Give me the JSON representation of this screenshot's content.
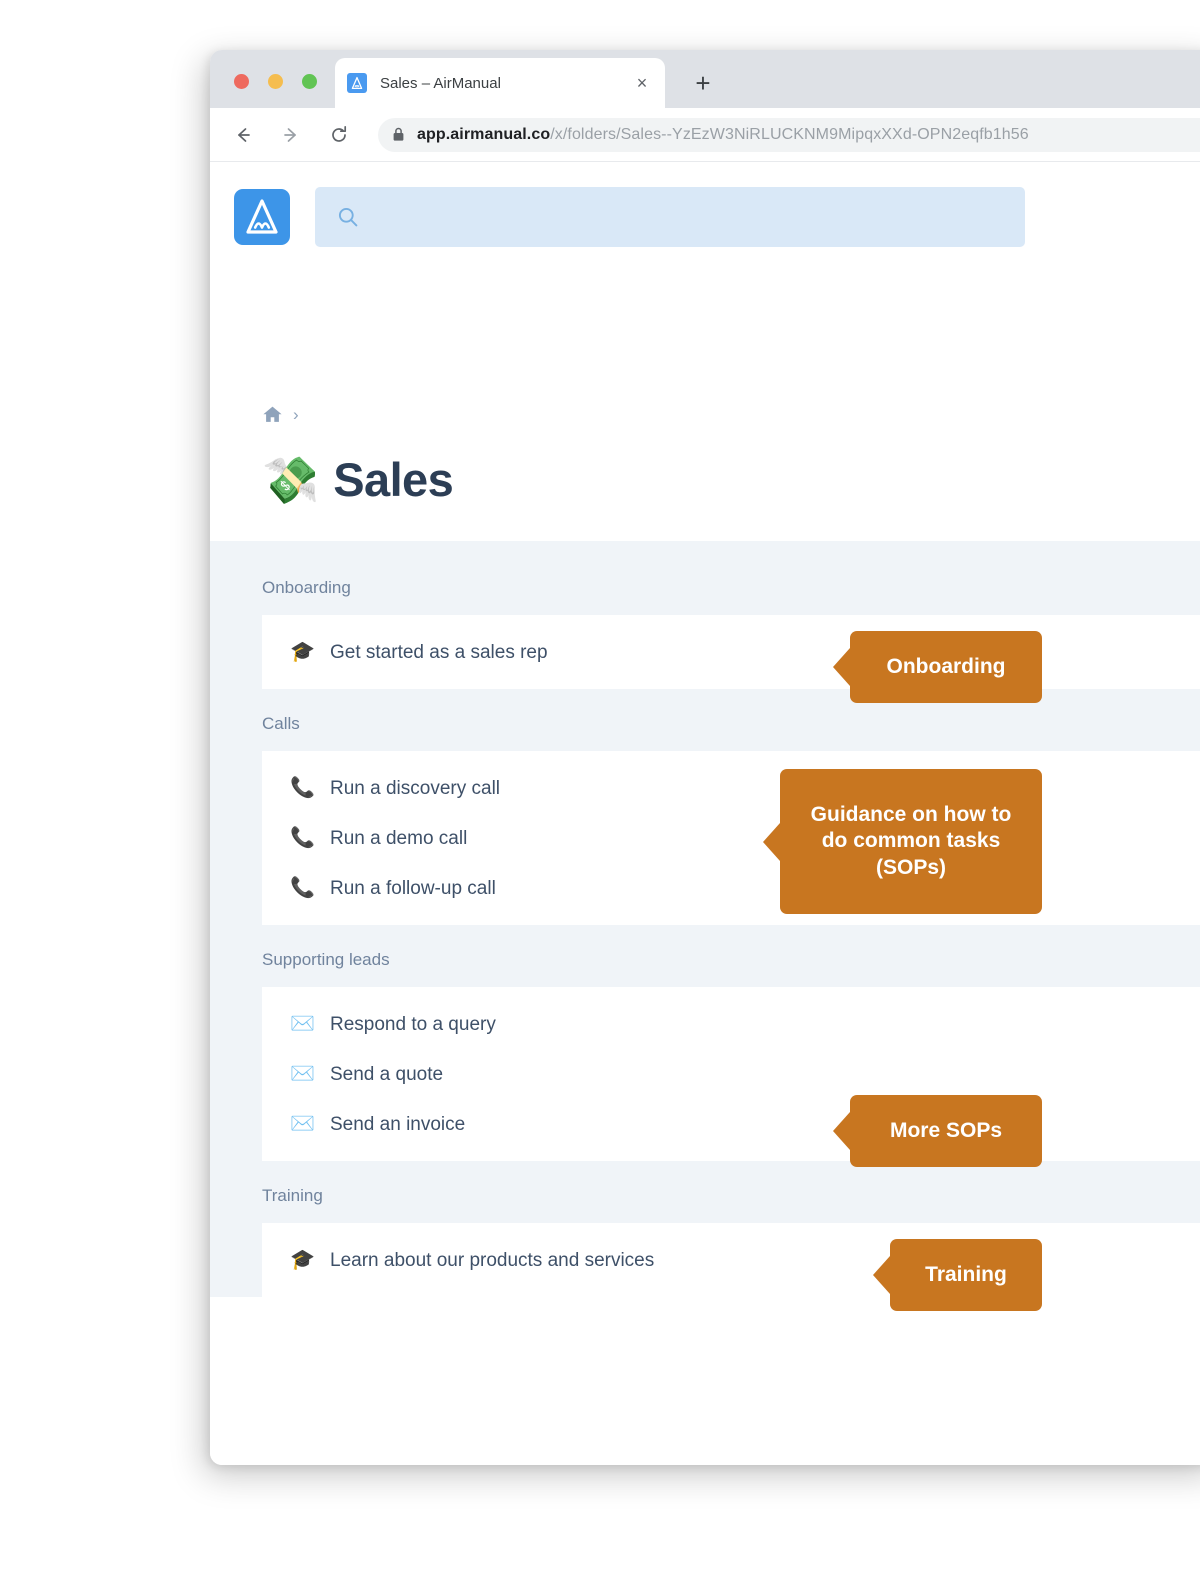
{
  "browser": {
    "traffic_lights": [
      {
        "name": "close",
        "color": "#ee6a5f"
      },
      {
        "name": "minimize",
        "color": "#f5bd4f"
      },
      {
        "name": "zoom",
        "color": "#61c454"
      }
    ],
    "tab": {
      "title": "Sales – AirManual",
      "favicon": "airmanual-logo-icon",
      "close_label": "×"
    },
    "new_tab_label": "+",
    "nav": {
      "back": "←",
      "forward": "→",
      "reload": "↻"
    },
    "omnibox": {
      "lock": "lock-icon",
      "host": "app.airmanual.co",
      "path": "/x/folders/Sales--YzEzW3NiRLUCKNM9MipqxXXd-OPN2eqfb1h56"
    }
  },
  "app": {
    "logo_name": "airmanual-logo",
    "search": {
      "placeholder": "",
      "value": "",
      "icon": "search-icon"
    },
    "breadcrumb": {
      "home_icon": "home-icon",
      "separator": "›"
    },
    "page": {
      "emoji": "💸",
      "title": "Sales"
    },
    "sections": [
      {
        "label": "Onboarding",
        "items": [
          {
            "icon": "🎓",
            "icon_name": "graduation-cap-icon",
            "label": "Get started as a sales rep"
          }
        ]
      },
      {
        "label": "Calls",
        "items": [
          {
            "icon": "📞",
            "icon_name": "telephone-icon",
            "label": "Run a discovery call"
          },
          {
            "icon": "📞",
            "icon_name": "telephone-icon",
            "label": "Run a demo call"
          },
          {
            "icon": "📞",
            "icon_name": "telephone-icon",
            "label": "Run a follow-up call"
          }
        ]
      },
      {
        "label": "Supporting leads",
        "items": [
          {
            "icon": "✉️",
            "icon_name": "envelope-icon",
            "label": "Respond to a query"
          },
          {
            "icon": "✉️",
            "icon_name": "envelope-icon",
            "label": "Send a quote"
          },
          {
            "icon": "✉️",
            "icon_name": "envelope-icon",
            "label": "Send an invoice"
          }
        ]
      },
      {
        "label": "Training",
        "items": [
          {
            "icon": "🎓",
            "icon_name": "graduation-cap-icon",
            "label": "Learn about our products and services"
          }
        ]
      }
    ],
    "callouts": {
      "onboarding": "Onboarding",
      "sops": "Guidance on how to do common tasks (SOPs)",
      "more_sops": "More SOPs",
      "training": "Training"
    }
  },
  "colors": {
    "callout_orange": "#c87620",
    "brand_blue": "#3d95e8",
    "title_navy": "#2c3e55",
    "section_bg": "#f0f4f8",
    "search_bg": "#d9e8f7"
  }
}
